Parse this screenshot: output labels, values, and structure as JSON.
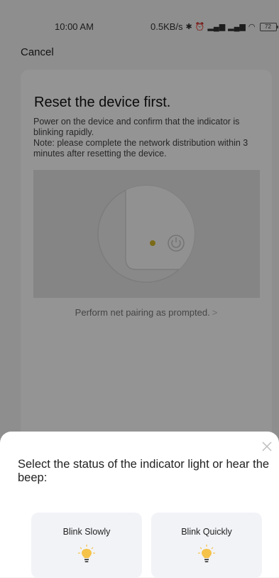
{
  "status_bar": {
    "time": "10:00 AM",
    "network_speed": "0.5KB/s",
    "battery": "72"
  },
  "header": {
    "cancel_label": "Cancel"
  },
  "instructions": {
    "title": "Reset the device first.",
    "line1": "Power on the device and confirm that the indicator is blinking rapidly.",
    "line2": "Note: please complete the network distribution within 3 minutes after resetting the device.",
    "pairing_link": "Perform net pairing as prompted.",
    "pairing_chevron": ">"
  },
  "sheet": {
    "prompt": "Select the status of the indicator light or hear the beep:",
    "options": [
      {
        "label": "Blink Slowly",
        "icon": "lightbulb-icon"
      },
      {
        "label": "Blink Quickly",
        "icon": "lightbulb-icon"
      }
    ]
  },
  "colors": {
    "indicator_dot": "#d4b92a",
    "bulb": "#f5c24a",
    "overlay": "rgba(0,0,0,0.42)"
  }
}
